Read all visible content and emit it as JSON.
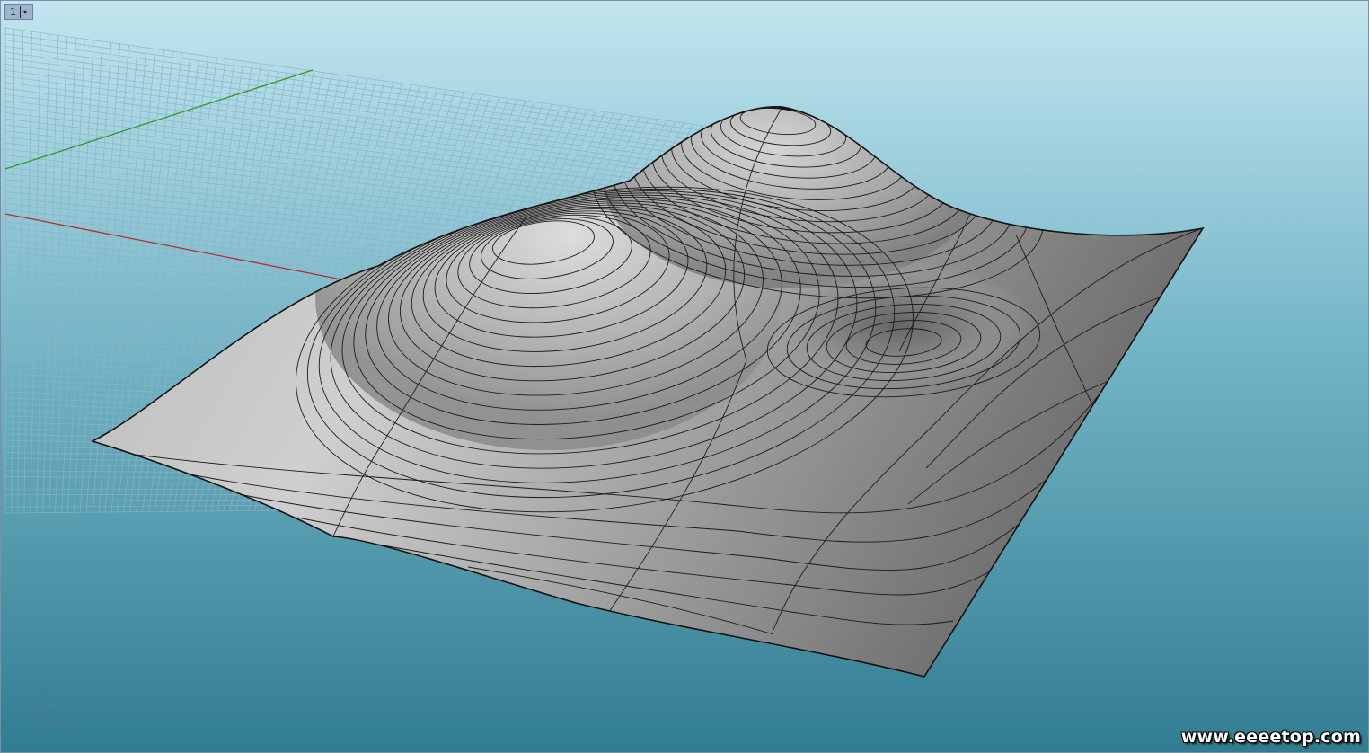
{
  "viewport": {
    "number": "1",
    "menu_arrow": "▾"
  },
  "axes_widget": {
    "z_label": "z",
    "y_label": "y",
    "x_label": "x"
  },
  "watermark": {
    "text": "www.eeeetop.com"
  },
  "colors": {
    "background_top": "#bfe3ee",
    "background_bottom": "#347e93",
    "grid_line": "#8fb2c0",
    "x_axis": "#b03030",
    "y_axis": "#2f9a2f",
    "surface": "#a9a9a9",
    "contour": "#1a1a1a"
  }
}
